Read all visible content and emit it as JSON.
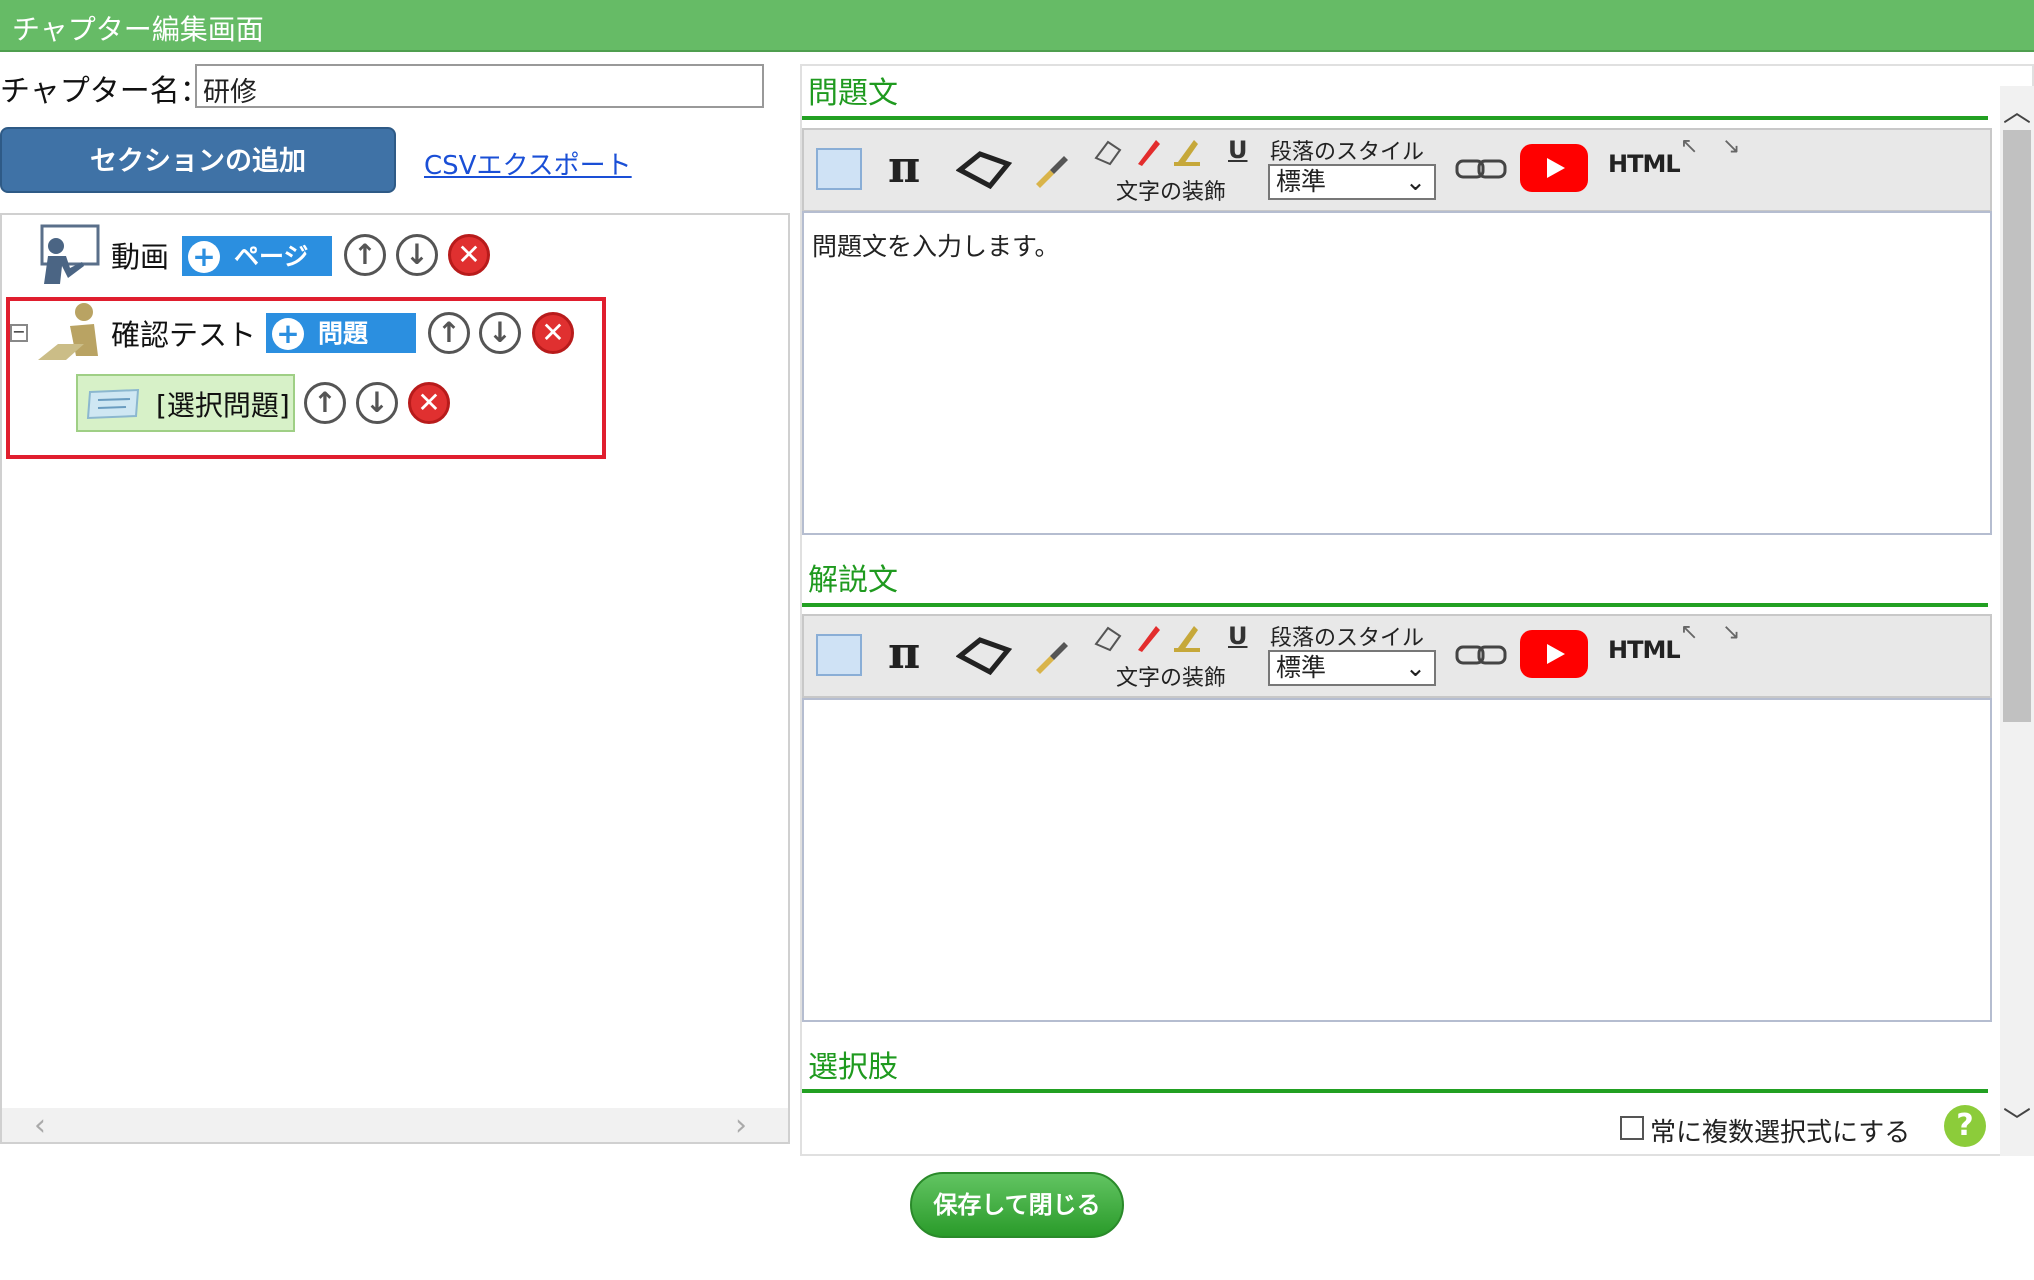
{
  "window": {
    "title": "チャプター編集画面"
  },
  "chapter": {
    "name_label": "チャプター名：",
    "name_value": "研修"
  },
  "actions": {
    "add_section": "セクションの追加",
    "csv_export": "CSVエクスポート",
    "save_close": "保存して閉じる"
  },
  "tree": {
    "video_section": {
      "label": "動画",
      "add_label": "ページ"
    },
    "test_section": {
      "label": "確認テスト",
      "add_label": "問題"
    },
    "question_item": {
      "label": "[選択問題]"
    }
  },
  "editor": {
    "question_title": "問題文",
    "explanation_title": "解説文",
    "choices_title": "選択肢",
    "question_text": "問題文を入力します。",
    "explanation_text": "",
    "toolbar": {
      "text_decoration": "文字の装飾",
      "paragraph_style": "段落のスタイル",
      "paragraph_value": "標準",
      "html_label": "HTML"
    },
    "multi_select_label": "常に複数選択式にする",
    "help_symbol": "?"
  },
  "colors": {
    "titlebar": "#66bb66",
    "accent_green": "#1f9a1f",
    "button_blue": "#3f72a6",
    "delete_red": "#e03030",
    "highlight_red": "#e01e2e"
  }
}
